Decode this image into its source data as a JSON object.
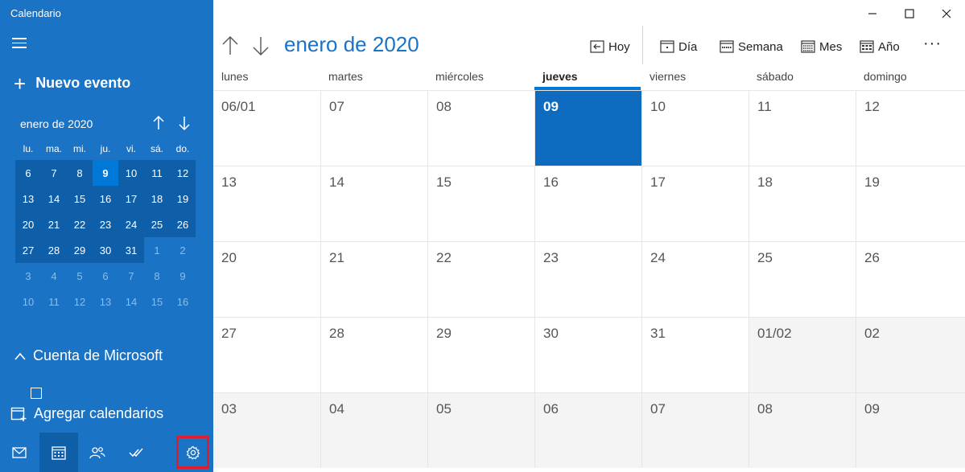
{
  "app_title": "Calendario",
  "sidebar": {
    "new_event_label": "Nuevo evento",
    "mini_calendar": {
      "title": "enero de 2020",
      "weekdays": [
        "lu.",
        "ma.",
        "mi.",
        "ju.",
        "vi.",
        "sá.",
        "do."
      ],
      "weeks": [
        [
          {
            "d": "6",
            "s": "cur"
          },
          {
            "d": "7",
            "s": "cur"
          },
          {
            "d": "8",
            "s": "cur"
          },
          {
            "d": "9",
            "s": "today"
          },
          {
            "d": "10",
            "s": "cur"
          },
          {
            "d": "11",
            "s": "cur"
          },
          {
            "d": "12",
            "s": "cur"
          }
        ],
        [
          {
            "d": "13",
            "s": "cur"
          },
          {
            "d": "14",
            "s": "cur"
          },
          {
            "d": "15",
            "s": "cur"
          },
          {
            "d": "16",
            "s": "cur"
          },
          {
            "d": "17",
            "s": "cur"
          },
          {
            "d": "18",
            "s": "cur"
          },
          {
            "d": "19",
            "s": "cur"
          }
        ],
        [
          {
            "d": "20",
            "s": "cur"
          },
          {
            "d": "21",
            "s": "cur"
          },
          {
            "d": "22",
            "s": "cur"
          },
          {
            "d": "23",
            "s": "cur"
          },
          {
            "d": "24",
            "s": "cur"
          },
          {
            "d": "25",
            "s": "cur"
          },
          {
            "d": "26",
            "s": "cur"
          }
        ],
        [
          {
            "d": "27",
            "s": "cur"
          },
          {
            "d": "28",
            "s": "cur"
          },
          {
            "d": "29",
            "s": "cur"
          },
          {
            "d": "30",
            "s": "cur"
          },
          {
            "d": "31",
            "s": "cur"
          },
          {
            "d": "1",
            "s": "other"
          },
          {
            "d": "2",
            "s": "other"
          }
        ],
        [
          {
            "d": "3",
            "s": "other"
          },
          {
            "d": "4",
            "s": "other"
          },
          {
            "d": "5",
            "s": "other"
          },
          {
            "d": "6",
            "s": "other"
          },
          {
            "d": "7",
            "s": "other"
          },
          {
            "d": "8",
            "s": "other"
          },
          {
            "d": "9",
            "s": "other"
          }
        ],
        [
          {
            "d": "10",
            "s": "other"
          },
          {
            "d": "11",
            "s": "other"
          },
          {
            "d": "12",
            "s": "other"
          },
          {
            "d": "13",
            "s": "other"
          },
          {
            "d": "14",
            "s": "other"
          },
          {
            "d": "15",
            "s": "other"
          },
          {
            "d": "16",
            "s": "other"
          }
        ]
      ]
    },
    "account_label": "Cuenta de Microsoft",
    "add_calendars_label": "Agregar calendarios",
    "bottom_nav": [
      {
        "name": "mail-icon"
      },
      {
        "name": "calendar-icon",
        "active": true
      },
      {
        "name": "people-icon"
      },
      {
        "name": "todo-icon"
      },
      {
        "name": "gear-icon",
        "highlighted": true
      }
    ]
  },
  "main": {
    "month_title": "enero de 2020",
    "toolbar": {
      "today_label": "Hoy",
      "day_label": "Día",
      "week_label": "Semana",
      "month_label": "Mes",
      "year_label": "Año",
      "more_label": "···"
    },
    "weekdays": [
      "lunes",
      "martes",
      "miércoles",
      "jueves",
      "viernes",
      "sábado",
      "domingo"
    ],
    "today_weekday_index": 3,
    "weeks": [
      [
        {
          "t": "06/01",
          "s": "cur"
        },
        {
          "t": "07",
          "s": "cur"
        },
        {
          "t": "08",
          "s": "cur"
        },
        {
          "t": "09",
          "s": "today"
        },
        {
          "t": "10",
          "s": "cur"
        },
        {
          "t": "11",
          "s": "cur"
        },
        {
          "t": "12",
          "s": "cur"
        }
      ],
      [
        {
          "t": "13",
          "s": "cur"
        },
        {
          "t": "14",
          "s": "cur"
        },
        {
          "t": "15",
          "s": "cur"
        },
        {
          "t": "16",
          "s": "cur"
        },
        {
          "t": "17",
          "s": "cur"
        },
        {
          "t": "18",
          "s": "cur"
        },
        {
          "t": "19",
          "s": "cur"
        }
      ],
      [
        {
          "t": "20",
          "s": "cur"
        },
        {
          "t": "21",
          "s": "cur"
        },
        {
          "t": "22",
          "s": "cur"
        },
        {
          "t": "23",
          "s": "cur"
        },
        {
          "t": "24",
          "s": "cur"
        },
        {
          "t": "25",
          "s": "cur"
        },
        {
          "t": "26",
          "s": "cur"
        }
      ],
      [
        {
          "t": "27",
          "s": "cur"
        },
        {
          "t": "28",
          "s": "cur"
        },
        {
          "t": "29",
          "s": "cur"
        },
        {
          "t": "30",
          "s": "cur"
        },
        {
          "t": "31",
          "s": "cur"
        },
        {
          "t": "01/02",
          "s": "other"
        },
        {
          "t": "02",
          "s": "other"
        }
      ],
      [
        {
          "t": "03",
          "s": "other"
        },
        {
          "t": "04",
          "s": "other"
        },
        {
          "t": "05",
          "s": "other"
        },
        {
          "t": "06",
          "s": "other"
        },
        {
          "t": "07",
          "s": "other"
        },
        {
          "t": "08",
          "s": "other"
        },
        {
          "t": "09",
          "s": "other"
        }
      ]
    ]
  },
  "colors": {
    "sidebar_bg": "#1a73c5",
    "accent": "#0078d7",
    "today_cell": "#0e6bc0",
    "settings_highlight": "#e11d2a"
  }
}
